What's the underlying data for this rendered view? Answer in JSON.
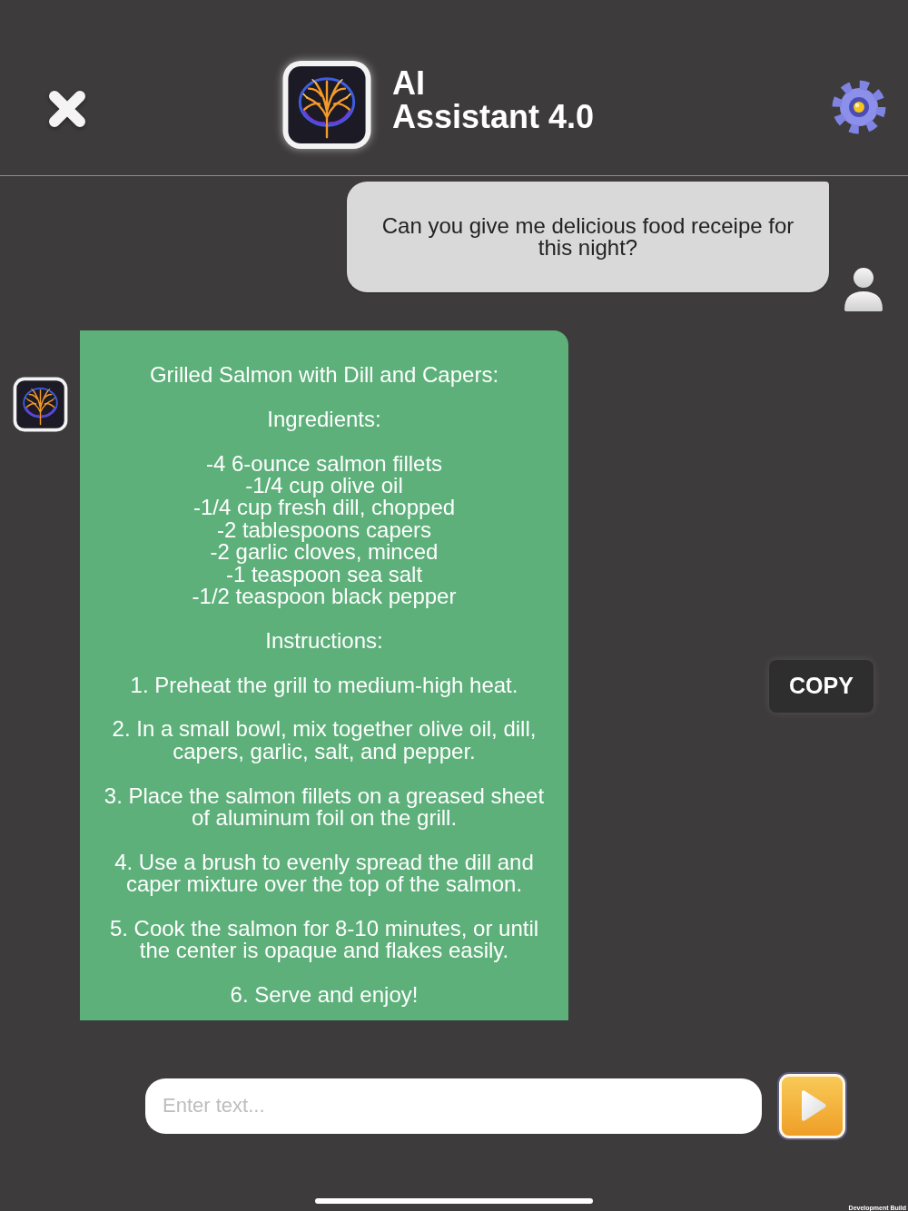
{
  "header": {
    "title": "AI\nAssistant 4.0"
  },
  "messages": [
    {
      "kind": "user",
      "text": "Can you give me delicious food receipe for this night?"
    },
    {
      "kind": "assistant",
      "title": "Grilled Salmon with Dill and Capers:",
      "sections": [
        {
          "kind": "list",
          "heading": "Ingredients:",
          "items": [
            "-4 6-ounce salmon fillets",
            "-1/4 cup olive oil",
            "-1/4 cup fresh dill, chopped",
            "-2 tablespoons capers",
            "-2 garlic cloves, minced",
            "-1 teaspoon sea salt",
            "-1/2 teaspoon black pepper"
          ]
        },
        {
          "kind": "steps",
          "heading": "Instructions:",
          "items": [
            "1. Preheat the grill to medium-high heat.",
            "2. In a small bowl, mix together olive oil, dill, capers, garlic, salt, and pepper.",
            "3. Place the salmon fillets on a greased sheet of aluminum foil on the grill.",
            "4. Use a brush to evenly spread the dill and caper mixture over the top of the salmon.",
            "5. Cook the salmon for 8-10 minutes, or until the center is opaque and flakes easily.",
            "6. Serve and enjoy!"
          ]
        }
      ],
      "copy_button": "COPY"
    }
  ],
  "composer": {
    "placeholder": "Enter text..."
  },
  "build_label": "Development Build"
}
